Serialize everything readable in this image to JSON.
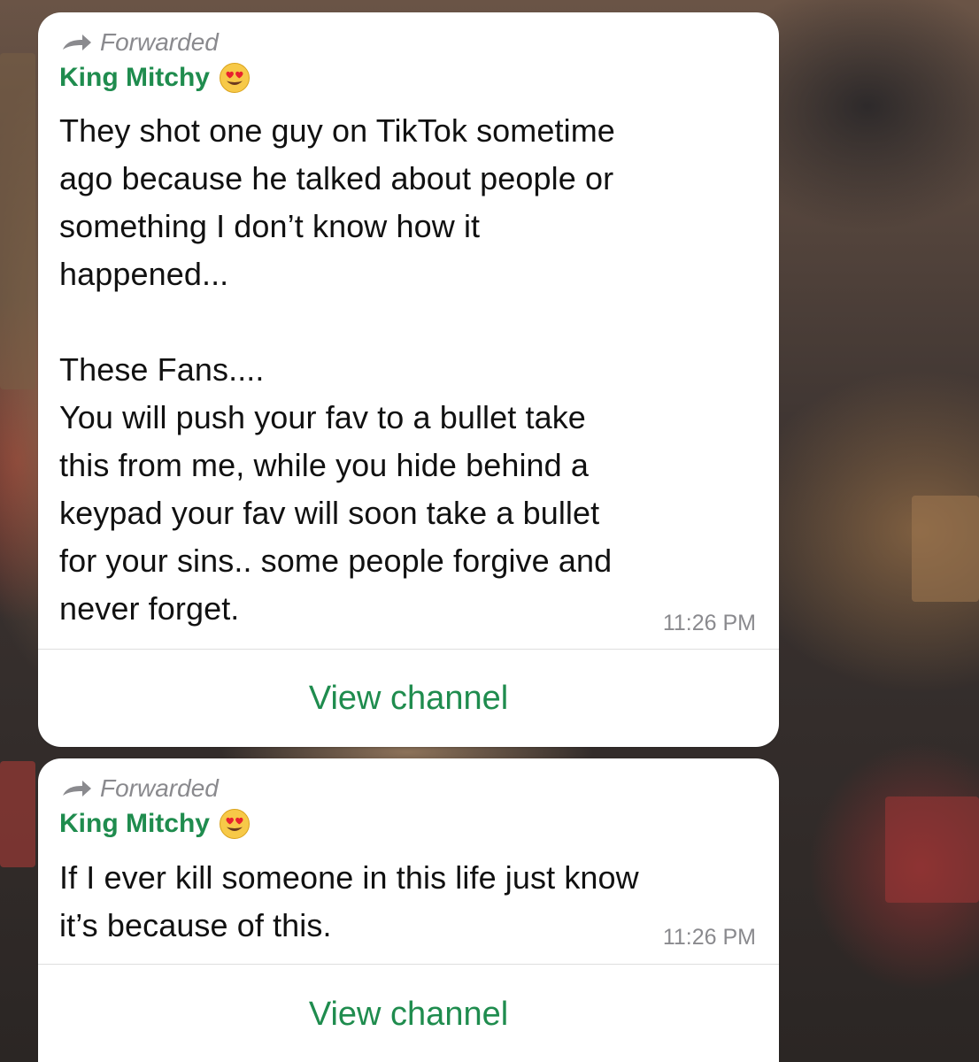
{
  "messages": [
    {
      "forwarded_label": "Forwarded",
      "sender": "King Mitchy",
      "sender_emoji": "heart-eyes-emoji",
      "text": "They shot one guy on TikTok sometime\nago because he talked about people or\nsomething I don’t know how it\nhappened...\n\nThese Fans....\nYou will push your fav to a bullet take\nthis from me, while you hide behind a\nkeypad your fav will soon take a bullet\nfor your sins.. some people forgive and\nnever forget.",
      "time": "11:26 PM",
      "action_label": "View channel"
    },
    {
      "forwarded_label": "Forwarded",
      "sender": "King Mitchy",
      "sender_emoji": "heart-eyes-emoji",
      "text": "If I ever kill someone in this life just know\nit’s because of this.",
      "time": "11:26 PM",
      "action_label": "View channel"
    }
  ],
  "colors": {
    "sender_green": "#1f8c4e",
    "action_green": "#1f8c4e",
    "meta_gray": "#8a8a8e",
    "bubble_bg": "#ffffff"
  },
  "icons": {
    "forward": "forward-arrow-icon"
  }
}
